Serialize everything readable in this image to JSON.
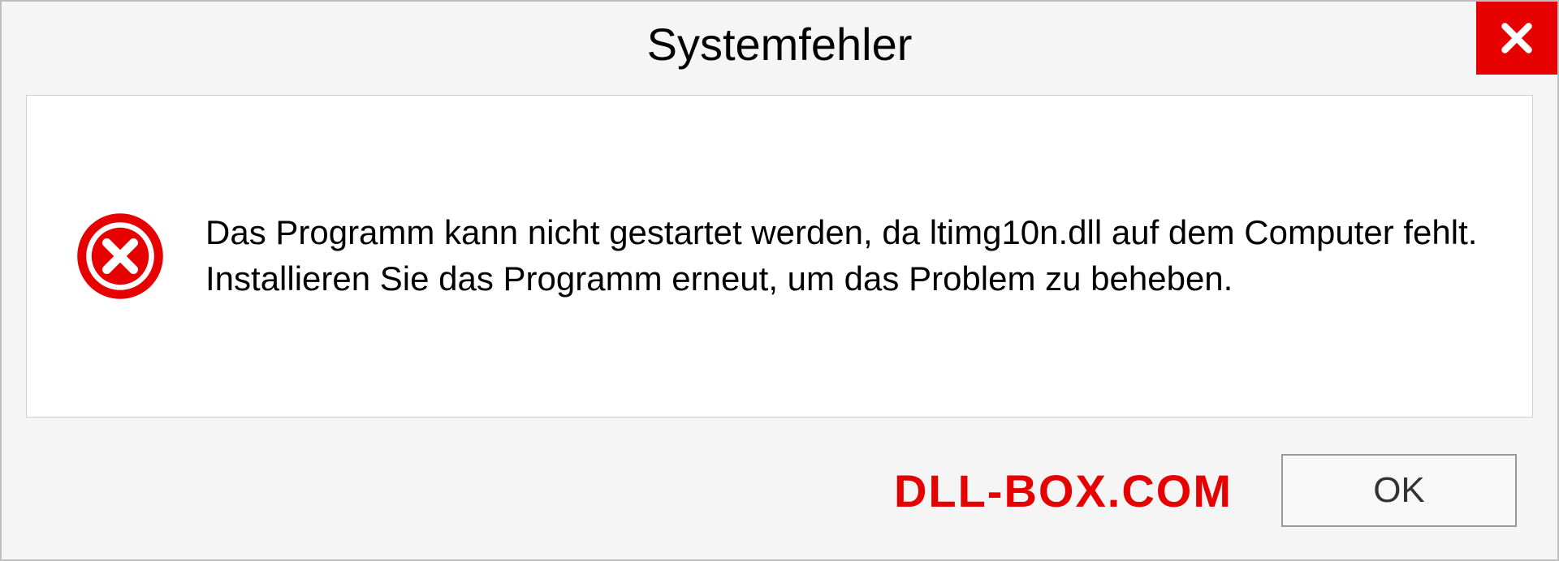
{
  "dialog": {
    "title": "Systemfehler",
    "message": "Das Programm kann nicht gestartet werden, da ltimg10n.dll auf dem Computer fehlt. Installieren Sie das Programm erneut, um das Problem zu beheben.",
    "ok_label": "OK",
    "watermark": "DLL-BOX.COM"
  }
}
